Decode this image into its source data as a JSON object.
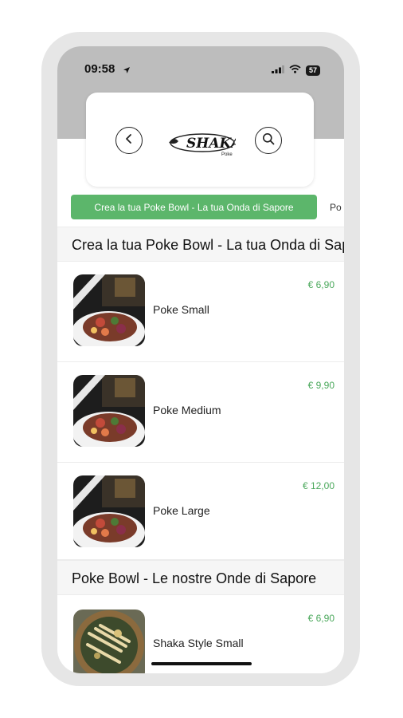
{
  "status_bar": {
    "time": "09:58",
    "battery": "57"
  },
  "header": {
    "logo_text": "SHAKA",
    "logo_sub": "Poke"
  },
  "category_chips": [
    {
      "label": "Crea la tua Poke Bowl - La tua Onda di Sapore",
      "active": true
    },
    {
      "label": "Po",
      "active": false
    }
  ],
  "sections": [
    {
      "title": "Crea la tua Poke Bowl - La tua Onda di Sapore",
      "items": [
        {
          "name": "Poke Small",
          "price": "€ 6,90"
        },
        {
          "name": "Poke Medium",
          "price": "€ 9,90"
        },
        {
          "name": "Poke Large",
          "price": "€ 12,00"
        }
      ]
    },
    {
      "title": "Poke Bowl - Le nostre Onde di Sapore",
      "items": [
        {
          "name": "Shaka Style Small",
          "price": "€ 6,90"
        }
      ]
    }
  ],
  "colors": {
    "accent": "#5cb66b",
    "price": "#4aa85b",
    "header_band": "#bdbdbd"
  }
}
